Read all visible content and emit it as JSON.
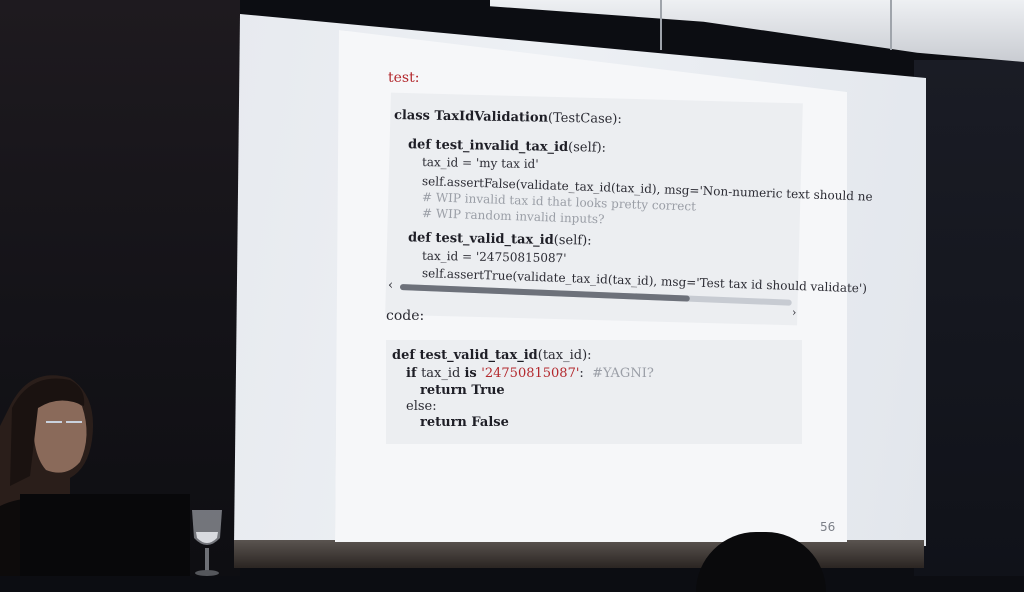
{
  "slide": {
    "section_test": "test:",
    "class_kw": "class ",
    "class_name": "TaxIdValidation",
    "class_args": "(TestCase):",
    "def1_kw": "def ",
    "def1_name": "test_invalid_tax_id",
    "def1_args": "(self):",
    "line_tax_id_1": "tax_id = 'my tax id'",
    "line_assert_false": "self.assertFalse(validate_tax_id(tax_id), msg='Non-numeric text should ne",
    "comment_1": "# WIP invalid tax id that looks pretty correct",
    "comment_2": "# WIP random invalid inputs?",
    "def2_kw": "def ",
    "def2_name": "test_valid_tax_id",
    "def2_args": "(self):",
    "line_tax_id_2": "tax_id = '24750815087'",
    "line_assert_true": "self.assertTrue(validate_tax_id(tax_id), msg='Test tax id should validate')",
    "scroll_left": "‹",
    "scroll_right": "›",
    "section_code": "code:",
    "def3_kw": "def ",
    "def3_name": "test_valid_tax_id",
    "def3_args": "(tax_id):",
    "if_kw": "if ",
    "if_expr": "tax_id ",
    "is_kw": "is ",
    "if_value": "'24750815087'",
    "if_colon": ":",
    "if_comment": "#YAGNI?",
    "return_true": "return True",
    "else_kw": "else:",
    "return_false": "return False",
    "page_number": "56",
    "scroll_fraction": 0.74
  },
  "colors": {
    "accent_red": "#b3282d",
    "slide_bg": "#f6f7f9",
    "code_bg": "#eceef1"
  }
}
